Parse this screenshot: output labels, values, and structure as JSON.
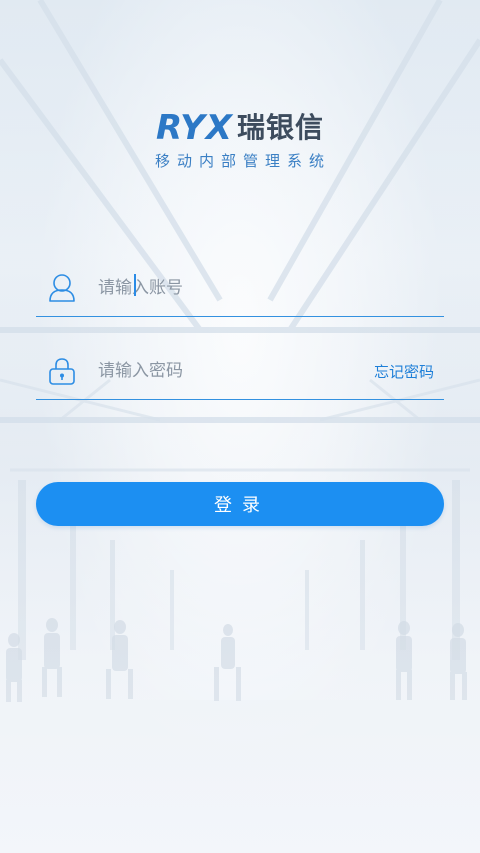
{
  "brand": {
    "mark": "RYX",
    "name_cn": "瑞银信",
    "subtitle": "移动内部管理系统",
    "mark_color": "#2c78c6"
  },
  "account": {
    "placeholder": "请输入账号",
    "value": "",
    "icon": "user-icon"
  },
  "password": {
    "placeholder": "请输入密码",
    "value": "",
    "icon": "lock-icon",
    "forgot_label": "忘记密码"
  },
  "login": {
    "label": "登录",
    "color": "#1c8ff2"
  },
  "colors": {
    "accent": "#1c8ff2",
    "underline": "#3391e0"
  }
}
